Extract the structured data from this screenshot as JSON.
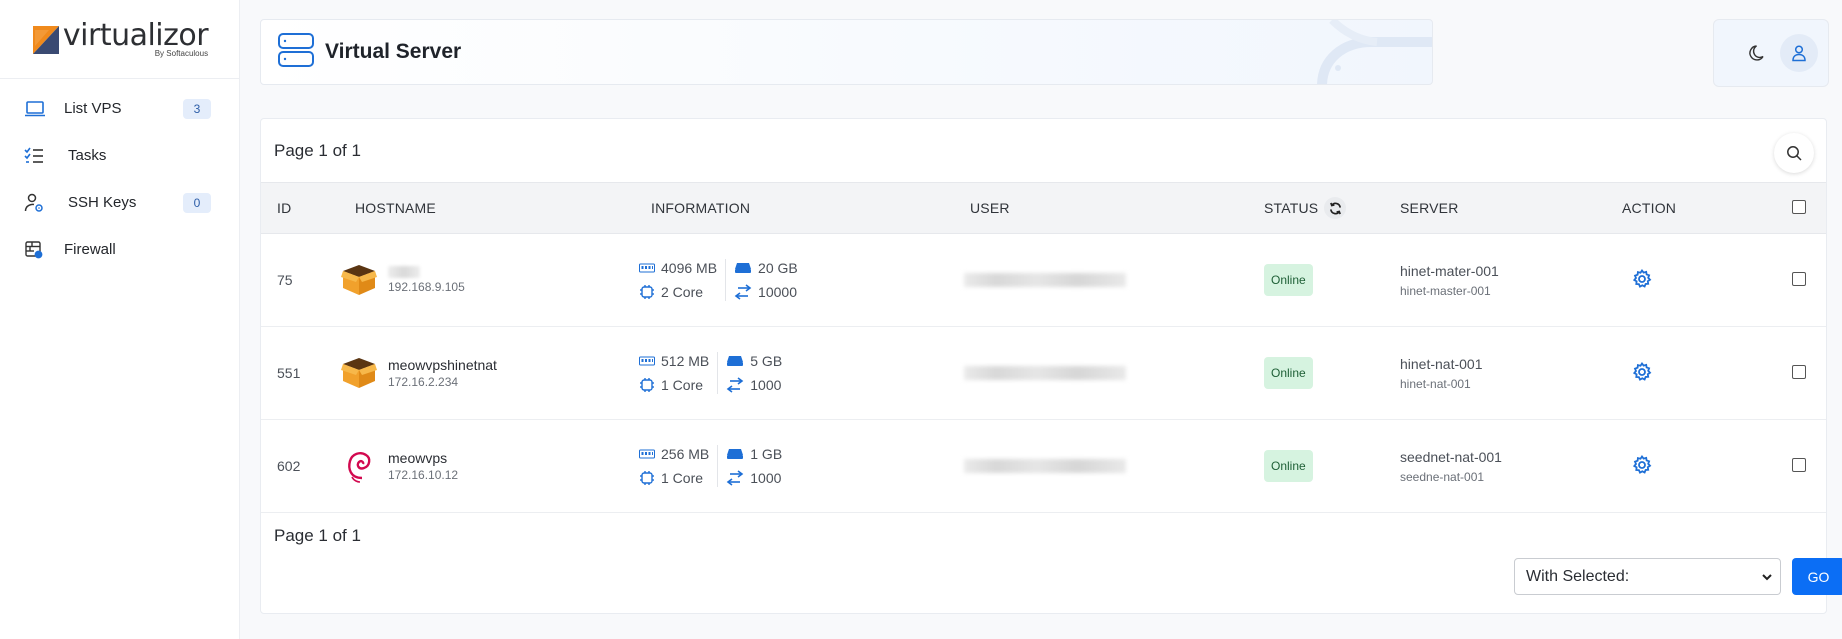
{
  "brand": {
    "name": "virtualizor",
    "byline": "By Softaculous",
    "colors": {
      "orange": "#f08a1c",
      "navy": "#3a4a72",
      "accent": "#0b6ef5"
    }
  },
  "sidebar": {
    "items": [
      {
        "label": "List VPS",
        "icon": "laptop-icon",
        "badge": "3"
      },
      {
        "label": "Tasks",
        "icon": "task-list-icon"
      },
      {
        "label": "SSH Keys",
        "icon": "user-key-icon",
        "badge": "0"
      },
      {
        "label": "Firewall",
        "icon": "firewall-icon"
      }
    ]
  },
  "header": {
    "title": "Virtual Server",
    "icon": "server-icon",
    "right_icons": [
      "moon-icon",
      "user-icon"
    ]
  },
  "table": {
    "page_info_top": "Page 1 of 1",
    "page_info_bottom": "Page 1 of 1",
    "columns": [
      "ID",
      "HOSTNAME",
      "INFORMATION",
      "USER",
      "STATUS",
      "SERVER",
      "ACTION"
    ],
    "rows": [
      {
        "id": "75",
        "os_icon": "box-icon",
        "hostname": "",
        "ip": "192.168.9.105",
        "ram": "4096 MB",
        "cores": "2 Core",
        "disk": "20 GB",
        "bandwidth": "10000",
        "status": "Online",
        "server": "hinet-mater-001",
        "server_sub": "hinet-master-001"
      },
      {
        "id": "551",
        "os_icon": "box-icon",
        "hostname": "meowvpshinetnat",
        "ip": "172.16.2.234",
        "ram": "512 MB",
        "cores": "1 Core",
        "disk": "5 GB",
        "bandwidth": "1000",
        "status": "Online",
        "server": "hinet-nat-001",
        "server_sub": "hinet-nat-001"
      },
      {
        "id": "602",
        "os_icon": "debian-icon",
        "hostname": "meowvps",
        "ip": "172.16.10.12",
        "ram": "256 MB",
        "cores": "1 Core",
        "disk": "1 GB",
        "bandwidth": "1000",
        "status": "Online",
        "server": "seednet-nat-001",
        "server_sub": "seedne-nat-001"
      }
    ]
  },
  "bulk": {
    "select_value": "With Selected:",
    "go_label": "GO"
  }
}
